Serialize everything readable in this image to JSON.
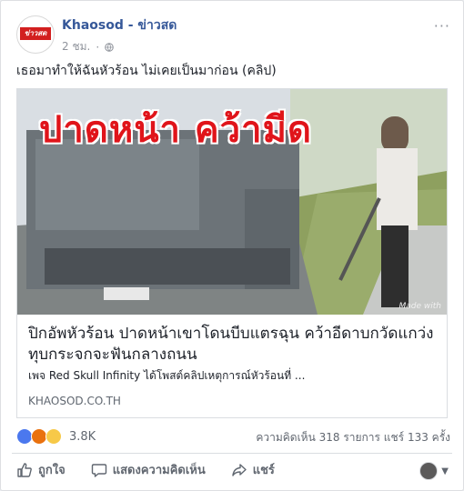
{
  "post": {
    "page_name": "Khaosod - ข่าวสด",
    "avatar_text": "ข่าวสด",
    "time": "2 ชม.",
    "more": "···",
    "caption": "เธอมาทำให้ฉันหัวร้อน ไม่เคยเป็นมาก่อน (คลิป)"
  },
  "link": {
    "image_overlay_text": "ปาดหน้า คว้ามีด",
    "image_watermark": "Made with",
    "title": "ปิกอัพหัวร้อน ปาดหน้าเขาโดนบีบแตรฉุน คว้าอีดาบกวัดแกว่ง ทุบกระจกจะฟันกลางถนน",
    "description": "เพจ Red Skull Infinity ได้โพสต์คลิปเหตุการณ์หัวร้อนที่ ...",
    "domain": "KHAOSOD.CO.TH"
  },
  "engagement": {
    "reaction_count": "3.8K",
    "comments_shares": "ความคิดเห็น 318 รายการ  แชร์ 133 ครั้ง"
  },
  "actions": {
    "like": "ถูกใจ",
    "comment": "แสดงความคิดเห็น",
    "share": "แชร์"
  }
}
